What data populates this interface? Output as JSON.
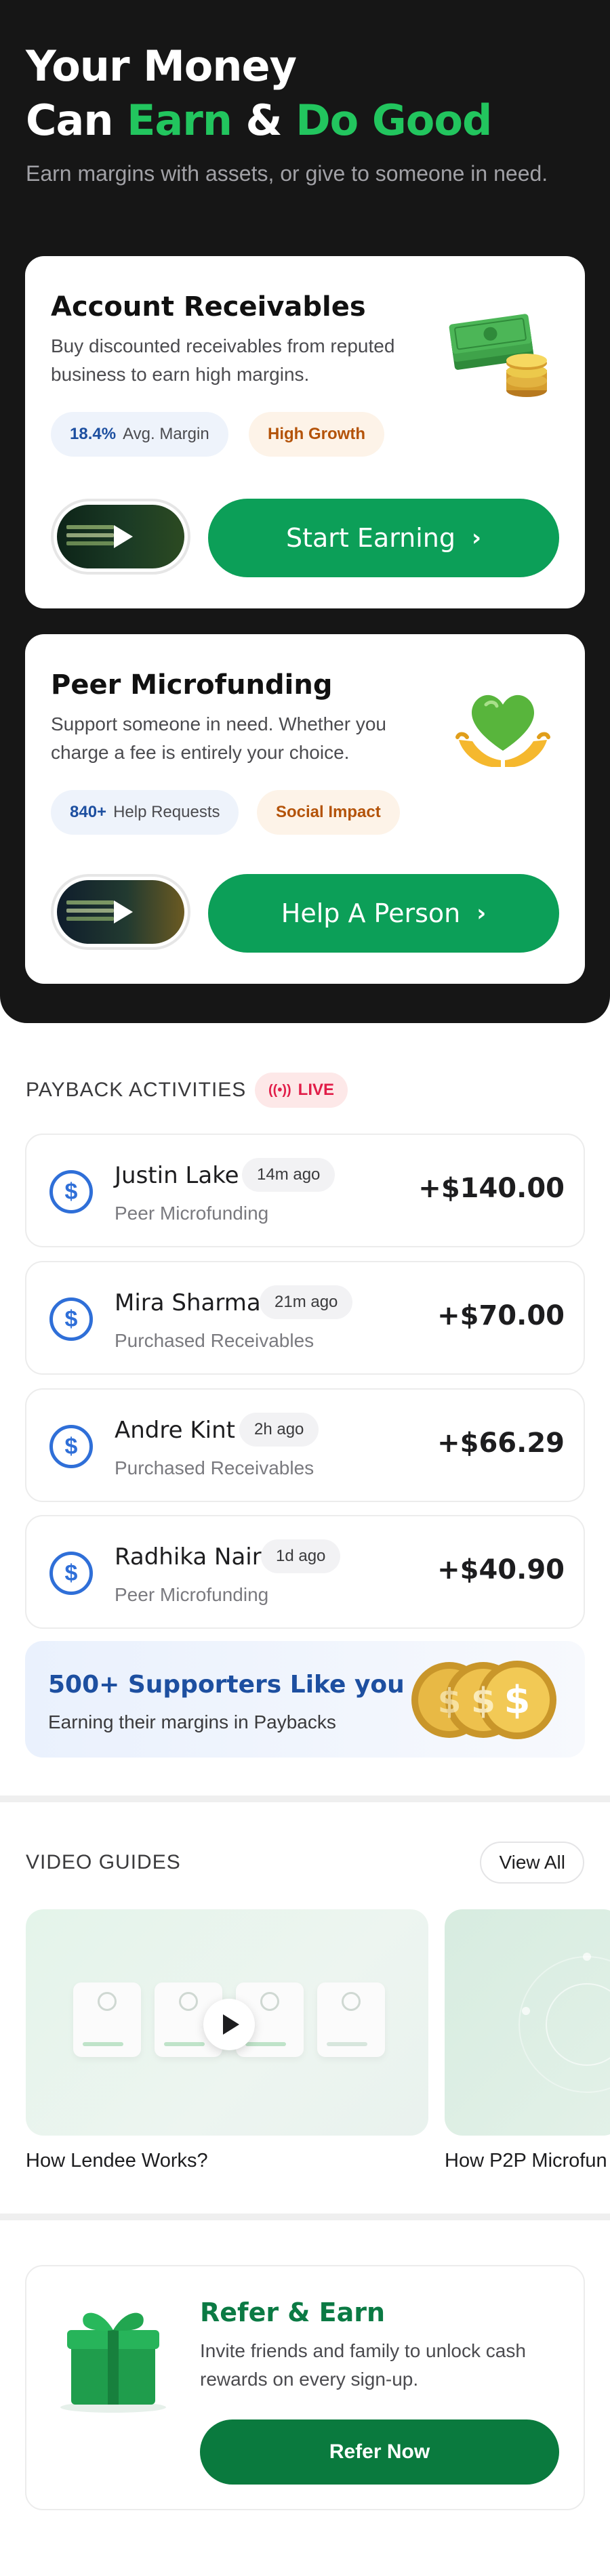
{
  "hero": {
    "title_line1": "Your Money",
    "title_line2_part1": "Can ",
    "title_line2_green1": "Earn",
    "title_line2_amp": " & ",
    "title_line2_green2": "Do Good",
    "subtitle": "Earn margins with assets, or give to someone in need.",
    "accent_color": "#22c55e"
  },
  "cards": [
    {
      "title": "Account Receivables",
      "description": "Buy discounted receivables from reputed business to earn high margins.",
      "stat_value": "18.4%",
      "stat_label": "Avg. Margin",
      "tag": "High Growth",
      "cta": "Start Earning",
      "icon": "money-stack-coins-icon"
    },
    {
      "title": "Peer Microfunding",
      "description": "Support someone in need. Whether you charge a fee is entirely your choice.",
      "stat_value": "840+",
      "stat_label": "Help Requests",
      "tag": "Social Impact",
      "cta": "Help A Person",
      "icon": "heart-hands-icon"
    }
  ],
  "payback": {
    "section_title": "PAYBACK ACTIVITIES",
    "live_label": "LIVE",
    "items": [
      {
        "name": "Justin Lake",
        "time": "14m ago",
        "type": "Peer Microfunding",
        "amount": "+$140.00"
      },
      {
        "name": "Mira Sharma",
        "time": "21m ago",
        "type": "Purchased Receivables",
        "amount": "+$70.00"
      },
      {
        "name": "Andre Kint",
        "time": "2h ago",
        "type": "Purchased Receivables",
        "amount": "+$66.29"
      },
      {
        "name": "Radhika Nair",
        "time": "1d ago",
        "type": "Peer Microfunding",
        "amount": "+$40.90"
      }
    ]
  },
  "supporters": {
    "title": "500+ Supporters Like you",
    "subtitle": "Earning their margins in Paybacks"
  },
  "video_guides": {
    "section_title": "VIDEO GUIDES",
    "view_all": "View All",
    "items": [
      {
        "caption": "How Lendee Works?"
      },
      {
        "caption": "How P2P Microfun"
      }
    ]
  },
  "refer": {
    "title": "Refer & Earn",
    "description": "Invite friends and family to unlock cash rewards on every sign-up.",
    "button": "Refer Now"
  },
  "colors": {
    "primary_green": "#0c9f58",
    "blue": "#2f6fd8",
    "live_red": "#e11d48"
  }
}
